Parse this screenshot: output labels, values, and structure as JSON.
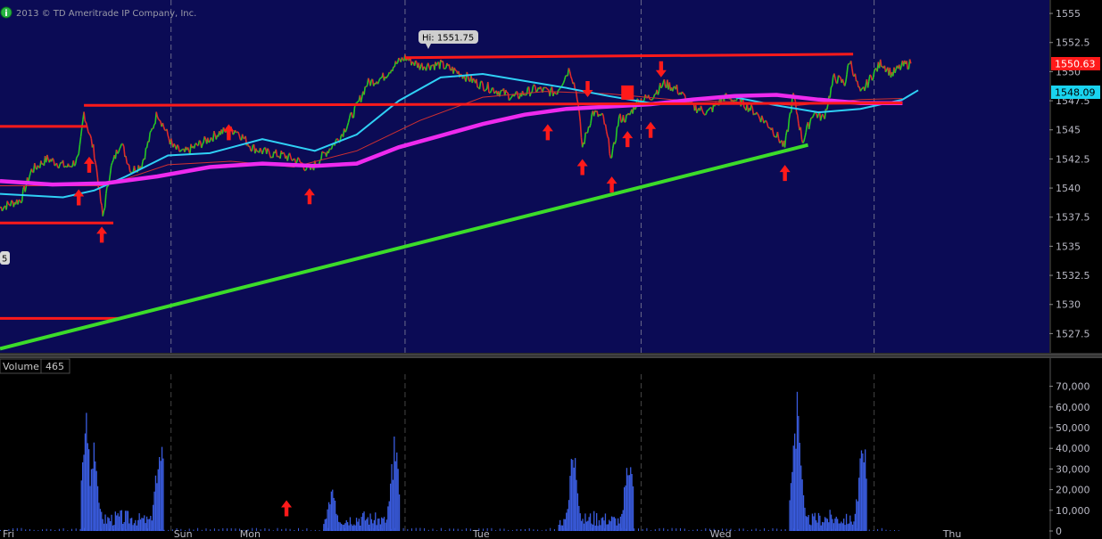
{
  "copyright": "2013 © TD Ameritrade IP Company, Inc.",
  "info_icon": "info-icon",
  "hi_label": "Hi: 1551.75",
  "partial_label": "5",
  "price_badges": [
    {
      "text": "1550.63",
      "color": "#ff1a1a",
      "text_color": "#ffffff"
    },
    {
      "text": "1548.09",
      "color": "#19d4f0",
      "text_color": "#000000"
    }
  ],
  "volume_panel": {
    "title": "Volume",
    "value": "465"
  },
  "colors": {
    "background": "#0b0b55",
    "bull": "#26c826",
    "bear": "#e02a2a",
    "sma_fast": "#2fd0f5",
    "sma_slow": "#ee2aee",
    "sma_thin": "#d23030",
    "volume": "#3a5ce0",
    "annotation": "#ff1a1a",
    "trendline": "#3cdc2a"
  },
  "chart_data": [
    {
      "type": "line",
      "ylim": [
        1526,
        1556
      ],
      "yticks": [
        "1555",
        "1552.5",
        "1550",
        "1547.5",
        "1545",
        "1542.5",
        "1540",
        "1537.5",
        "1535",
        "1532.5",
        "1530",
        "1527.5"
      ],
      "ytick_values": [
        1555,
        1552.5,
        1550,
        1547.5,
        1545,
        1542.5,
        1540,
        1537.5,
        1535,
        1532.5,
        1530,
        1527.5
      ],
      "xlim": [
        0,
        100
      ],
      "day_dividers": [
        16.3,
        38.6,
        61.1,
        83.3
      ],
      "price_path": [
        [
          0,
          1538.3
        ],
        [
          2,
          1539.0
        ],
        [
          3,
          1541.5
        ],
        [
          4.5,
          1542.5
        ],
        [
          6.5,
          1541.8
        ],
        [
          7.5,
          1542.5
        ],
        [
          8,
          1546.5
        ],
        [
          9,
          1543.0
        ],
        [
          9.8,
          1537.5
        ],
        [
          10.5,
          1541.5
        ],
        [
          11.5,
          1544.0
        ],
        [
          12.5,
          1541.5
        ],
        [
          13.5,
          1542.0
        ],
        [
          15,
          1546.5
        ],
        [
          16.5,
          1543.5
        ],
        [
          17.5,
          1543.0
        ],
        [
          19.5,
          1544.0
        ],
        [
          21,
          1544.8
        ],
        [
          22.5,
          1545.0
        ],
        [
          24,
          1543.5
        ],
        [
          25.5,
          1543.0
        ],
        [
          27,
          1542.8
        ],
        [
          28.5,
          1542.3
        ],
        [
          29.5,
          1541.5
        ],
        [
          30.5,
          1542.5
        ],
        [
          31.5,
          1543.5
        ],
        [
          32.5,
          1544.5
        ],
        [
          34,
          1547.0
        ],
        [
          35,
          1549.0
        ],
        [
          36.5,
          1549.5
        ],
        [
          37.5,
          1550.5
        ],
        [
          38.6,
          1551.2
        ],
        [
          40,
          1550.5
        ],
        [
          42,
          1550.6
        ],
        [
          44,
          1549.8
        ],
        [
          45.5,
          1549.0
        ],
        [
          47,
          1548.5
        ],
        [
          49,
          1547.8
        ],
        [
          51,
          1548.5
        ],
        [
          53,
          1548.2
        ],
        [
          54.3,
          1550.3
        ],
        [
          55,
          1548.0
        ],
        [
          55.5,
          1543.5
        ],
        [
          56.5,
          1546.5
        ],
        [
          57.5,
          1546.0
        ],
        [
          58.3,
          1542.5
        ],
        [
          59,
          1546.0
        ],
        [
          59.8,
          1546.0
        ],
        [
          60.8,
          1547.5
        ],
        [
          62,
          1547.8
        ],
        [
          63.3,
          1549.0
        ],
        [
          64.5,
          1548.5
        ],
        [
          66,
          1547.0
        ],
        [
          67.5,
          1546.5
        ],
        [
          69,
          1547.8
        ],
        [
          70.5,
          1547.5
        ],
        [
          72,
          1546.5
        ],
        [
          73.5,
          1545.2
        ],
        [
          74.8,
          1543.5
        ],
        [
          75.6,
          1548.0
        ],
        [
          76.5,
          1544.0
        ],
        [
          77.5,
          1546.5
        ],
        [
          78.5,
          1546.0
        ],
        [
          79.5,
          1549.5
        ],
        [
          80.5,
          1549.0
        ],
        [
          81,
          1551.0
        ],
        [
          82,
          1548.0
        ],
        [
          83,
          1549.5
        ],
        [
          84,
          1550.8
        ],
        [
          85,
          1549.8
        ],
        [
          86,
          1550.5
        ],
        [
          86.8,
          1550.7
        ]
      ],
      "sma_fast_path": [
        [
          0,
          1539.5
        ],
        [
          6,
          1539.2
        ],
        [
          9,
          1539.8
        ],
        [
          12,
          1541.0
        ],
        [
          16,
          1542.8
        ],
        [
          20,
          1543.0
        ],
        [
          25,
          1544.2
        ],
        [
          30,
          1543.2
        ],
        [
          34,
          1544.6
        ],
        [
          38,
          1547.5
        ],
        [
          42,
          1549.5
        ],
        [
          46,
          1549.8
        ],
        [
          50,
          1549.2
        ],
        [
          54,
          1548.6
        ],
        [
          58,
          1547.9
        ],
        [
          62,
          1547.3
        ],
        [
          66,
          1547.6
        ],
        [
          70,
          1547.8
        ],
        [
          74,
          1547.1
        ],
        [
          78,
          1546.5
        ],
        [
          82,
          1546.8
        ],
        [
          86,
          1547.6
        ],
        [
          87.5,
          1548.4
        ]
      ],
      "sma_slow_path": [
        [
          0,
          1540.6
        ],
        [
          5,
          1540.3
        ],
        [
          10,
          1540.4
        ],
        [
          15,
          1541.0
        ],
        [
          20,
          1541.8
        ],
        [
          25,
          1542.1
        ],
        [
          30,
          1541.9
        ],
        [
          34,
          1542.1
        ],
        [
          38,
          1543.5
        ],
        [
          42,
          1544.5
        ],
        [
          46,
          1545.5
        ],
        [
          50,
          1546.3
        ],
        [
          54,
          1546.8
        ],
        [
          58,
          1547.0
        ],
        [
          62,
          1547.2
        ],
        [
          66,
          1547.6
        ],
        [
          70,
          1547.9
        ],
        [
          74,
          1548.0
        ],
        [
          78,
          1547.6
        ],
        [
          82,
          1547.3
        ],
        [
          86,
          1547.3
        ]
      ],
      "sma_thin_path": [
        [
          0,
          1540.2
        ],
        [
          10,
          1540.2
        ],
        [
          16,
          1542.0
        ],
        [
          22,
          1542.3
        ],
        [
          28,
          1541.8
        ],
        [
          34,
          1543.2
        ],
        [
          40,
          1545.8
        ],
        [
          46,
          1547.8
        ],
        [
          52,
          1548.3
        ],
        [
          58,
          1548.1
        ],
        [
          64,
          1547.6
        ],
        [
          70,
          1547.4
        ],
        [
          76,
          1547.1
        ],
        [
          82,
          1547.6
        ],
        [
          86,
          1547.7
        ]
      ],
      "resistance_lines": [
        {
          "x": [
            0,
            8.3
          ],
          "y": [
            1545.3,
            1545.3
          ]
        },
        {
          "x": [
            0,
            10.8
          ],
          "y": [
            1537.0,
            1537.0
          ]
        },
        {
          "x": [
            0,
            11.3
          ],
          "y": [
            1528.8,
            1528.8
          ]
        },
        {
          "x": [
            8,
            86
          ],
          "y": [
            1547.1,
            1547.3
          ]
        },
        {
          "x": [
            38.6,
            81.3
          ],
          "y": [
            1551.2,
            1551.5
          ]
        }
      ],
      "support_line": {
        "x": [
          0,
          77
        ],
        "y": [
          1526.2,
          1543.7
        ]
      },
      "arrows_up": [
        [
          7.5,
          1539.2
        ],
        [
          8.5,
          1542.0
        ],
        [
          9.7,
          1536.0
        ],
        [
          21.8,
          1544.8
        ],
        [
          29.5,
          1539.3
        ],
        [
          52.2,
          1544.8
        ],
        [
          55.5,
          1541.8
        ],
        [
          58.3,
          1540.3
        ],
        [
          59.8,
          1544.2
        ],
        [
          62.0,
          1545.0
        ],
        [
          74.8,
          1541.3
        ]
      ],
      "arrows_down": [
        [
          56.0,
          1548.5
        ],
        [
          63.0,
          1550.2
        ]
      ],
      "block_marker": [
        59.8,
        1548.2
      ]
    },
    {
      "type": "bar",
      "title": "Volume",
      "ylim": [
        0,
        75000
      ],
      "yticks": [
        "70,000",
        "60,000",
        "50,000",
        "40,000",
        "30,000",
        "20,000",
        "10,000",
        "0"
      ],
      "ytick_values": [
        70000,
        60000,
        50000,
        40000,
        30000,
        20000,
        10000,
        0
      ],
      "xticks": [
        "Fri",
        "Sun",
        "Mon",
        "Tue",
        "Wed",
        "Thu"
      ],
      "xtick_positions": [
        0,
        16.3,
        22.6,
        44.8,
        67.4,
        89.6
      ],
      "bursts": [
        {
          "start": 7.7,
          "end": 15.6,
          "peaks": [
            [
              8.1,
              64000
            ],
            [
              8.9,
              48000
            ],
            [
              15.2,
              54000
            ]
          ]
        },
        {
          "start": 30.8,
          "end": 38.0,
          "peaks": [
            [
              31.6,
              24000
            ],
            [
              37.6,
              52000
            ]
          ]
        },
        {
          "start": 53.2,
          "end": 60.3,
          "peaks": [
            [
              54.6,
              46000
            ],
            [
              59.9,
              44000
            ]
          ]
        },
        {
          "start": 75.2,
          "end": 82.6,
          "peaks": [
            [
              75.9,
              73000
            ],
            [
              82.2,
              55000
            ]
          ]
        }
      ],
      "arrow_up": [
        27.3,
        11000
      ]
    }
  ]
}
